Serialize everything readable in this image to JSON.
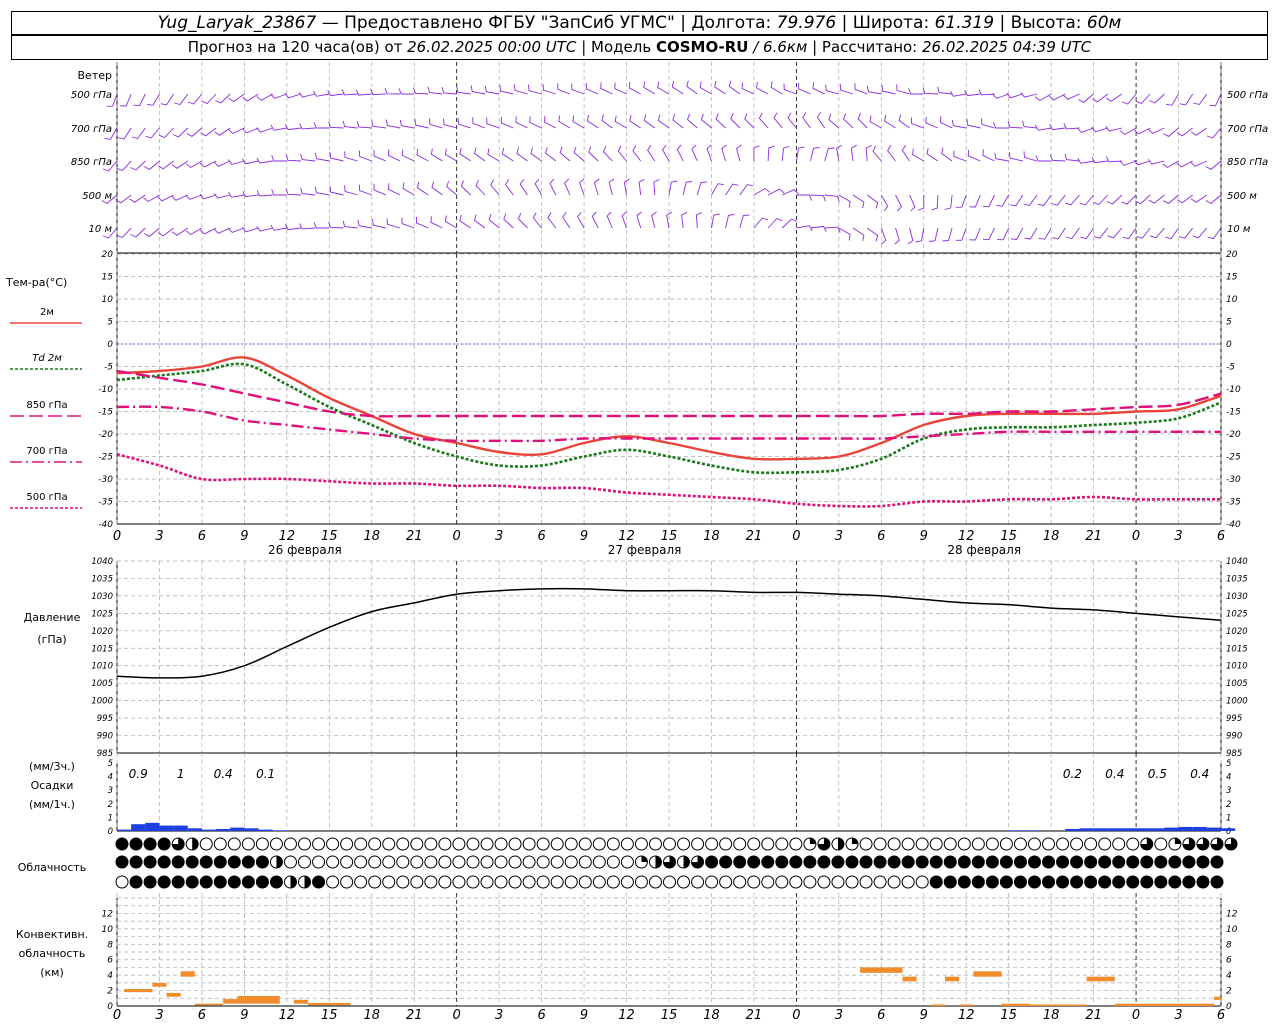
{
  "header": {
    "station": "Yug_Laryak_23867",
    "provider": "— Предоставлено ФГБУ \"ЗапСиб УГМС\"",
    "sep": "|",
    "lon_label": "Долгота:",
    "lon": "79.976",
    "lat_label": "Широта:",
    "lat": "61.319",
    "alt_label": "Высота:",
    "alt": "60м",
    "forecast_label": "Прогноз на 120 часа(ов) от",
    "forecast_start": "26.02.2025 00:00 UTC",
    "model_label": "Модель",
    "model": "COSMO-RU",
    "model_res": "/ 6.6км",
    "computed_label": "Рассчитано:",
    "computed": "26.02.2025 04:39 UTC"
  },
  "wind_panel": {
    "title": "Ветер",
    "levels": [
      "500 гПа",
      "700 гПа",
      "850 гПа",
      "500 м",
      "10 м"
    ],
    "barb_color": "#8a2be2"
  },
  "time_axis": {
    "hour_labels": [
      "0",
      "3",
      "6",
      "9",
      "12",
      "15",
      "18",
      "21",
      "0",
      "3",
      "6",
      "9",
      "12",
      "15",
      "18",
      "21",
      "0",
      "3",
      "6",
      "9",
      "12",
      "15",
      "18",
      "21",
      "0",
      "3",
      "6"
    ],
    "day_labels": [
      "26 февраля",
      "27 февраля",
      "28 февраля"
    ]
  },
  "chart_data": [
    {
      "type": "line",
      "panel": "temperature",
      "ylabel": "Тем-ра(°C)",
      "ylim": [
        -40,
        20
      ],
      "yticks": [
        "20",
        "15",
        "10",
        "5",
        "0",
        "-5",
        "-10",
        "-15",
        "-20",
        "-25",
        "-30",
        "-35",
        "-40"
      ],
      "x_hours": [
        0,
        3,
        6,
        9,
        12,
        15,
        18,
        21,
        24,
        27,
        30,
        33,
        36,
        39,
        42,
        45,
        48,
        51,
        54,
        57,
        60,
        63,
        66,
        69,
        72,
        75,
        78
      ],
      "series": [
        {
          "name": "2м",
          "color": "#e8443a",
          "dash": "solid",
          "values": [
            -6.5,
            -6,
            -5,
            -3,
            -7,
            -12,
            -16,
            -20,
            -22,
            -24,
            -24.5,
            -22,
            -20.5,
            -22,
            -24,
            -25.5,
            -25.5,
            -25,
            -22,
            -18,
            -16,
            -15.5,
            -15.5,
            -15.5,
            -15,
            -14.5,
            -11.5
          ]
        },
        {
          "name": "Td 2м",
          "color": "#1a7a1a",
          "dash": "dot",
          "values": [
            -8,
            -7,
            -6,
            -4.5,
            -9,
            -14,
            -18,
            -22,
            -25,
            -27,
            -27,
            -25,
            -23.5,
            -25,
            -27,
            -28.5,
            -28.5,
            -28,
            -25.5,
            -21,
            -19,
            -18.5,
            -18.5,
            -18,
            -17.5,
            -16.5,
            -13
          ]
        },
        {
          "name": "850 гПа",
          "color": "#e0107a",
          "dash": "longdash",
          "values": [
            -6,
            -7.5,
            -9,
            -11,
            -13,
            -15,
            -16,
            -16,
            -16,
            -16,
            -16,
            -16,
            -16,
            -16,
            -16,
            -16,
            -16,
            -16,
            -16,
            -15.5,
            -15.5,
            -15,
            -15,
            -14.5,
            -14,
            -13.5,
            -11
          ]
        },
        {
          "name": "700 гПа",
          "color": "#e0107a",
          "dash": "dashdot",
          "values": [
            -14,
            -14,
            -15,
            -17,
            -18,
            -19,
            -20,
            -21,
            -21.5,
            -21.5,
            -21.5,
            -21,
            -21,
            -21,
            -21,
            -21,
            -21,
            -21,
            -21,
            -20.5,
            -20,
            -19.5,
            -19.5,
            -19.5,
            -19.5,
            -19.5,
            -19.5
          ]
        },
        {
          "name": "500 гПа",
          "color": "#e0107a",
          "dash": "dot",
          "values": [
            -24.5,
            -27,
            -30,
            -30,
            -30,
            -30.5,
            -31,
            -31,
            -31.5,
            -31.5,
            -32,
            -32,
            -33,
            -33.5,
            -34,
            -34.5,
            -35.5,
            -36,
            -36,
            -35,
            -35,
            -34.5,
            -34.5,
            -34,
            -34.5,
            -34.5,
            -34.5
          ]
        }
      ]
    },
    {
      "type": "line",
      "panel": "pressure",
      "ylabel": "Давление",
      "unit": "(гПа)",
      "ylim": [
        985,
        1040
      ],
      "yticks": [
        "1040",
        "1035",
        "1030",
        "1025",
        "1020",
        "1015",
        "1010",
        "1005",
        "1000",
        "995",
        "990",
        "985"
      ],
      "x_hours": [
        0,
        3,
        6,
        9,
        12,
        15,
        18,
        21,
        24,
        27,
        30,
        33,
        36,
        39,
        42,
        45,
        48,
        51,
        54,
        57,
        60,
        63,
        66,
        69,
        72,
        75,
        78
      ],
      "series": [
        {
          "name": "",
          "color": "#000000",
          "values": [
            1007,
            1006.5,
            1007,
            1010,
            1015.5,
            1021,
            1025.5,
            1028,
            1030.5,
            1031.5,
            1032,
            1032,
            1031.5,
            1031.5,
            1031.5,
            1031,
            1031,
            1030.5,
            1030,
            1029,
            1028,
            1027.5,
            1026.5,
            1026,
            1025,
            1024,
            1023
          ]
        }
      ]
    },
    {
      "type": "bar",
      "panel": "precipitation",
      "ylabel": "Осадки",
      "unit_top": "(мм/3ч.)",
      "unit_bottom": "(мм/1ч.)",
      "ylim": [
        0,
        5
      ],
      "yticks": [
        "5",
        "4",
        "3",
        "2",
        "1",
        "0"
      ],
      "sum_labels": [
        {
          "hour": 1.5,
          "text": "0.9"
        },
        {
          "hour": 4.5,
          "text": "1"
        },
        {
          "hour": 7.5,
          "text": "0.4"
        },
        {
          "hour": 10.5,
          "text": "0.1"
        },
        {
          "hour": 67.5,
          "text": "0.2"
        },
        {
          "hour": 70.5,
          "text": "0.4"
        },
        {
          "hour": 73.5,
          "text": "0.5"
        },
        {
          "hour": 76.5,
          "text": "0.4"
        }
      ],
      "color": "#1f3fe0",
      "hourly": [
        0.1,
        0.5,
        0.6,
        0.4,
        0.4,
        0.2,
        0.1,
        0.15,
        0.25,
        0.2,
        0.1,
        0.05,
        0,
        0,
        0,
        0,
        0,
        0,
        0,
        0,
        0,
        0,
        0,
        0,
        0,
        0,
        0,
        0,
        0,
        0,
        0,
        0,
        0,
        0,
        0,
        0,
        0,
        0,
        0,
        0,
        0,
        0,
        0,
        0,
        0,
        0,
        0,
        0,
        0,
        0,
        0,
        0,
        0,
        0,
        0,
        0,
        0,
        0,
        0,
        0,
        0,
        0,
        0,
        0.05,
        0.05,
        0,
        0,
        0.15,
        0.2,
        0.2,
        0.2,
        0.2,
        0.2,
        0.2,
        0.25,
        0.3,
        0.3,
        0.25,
        0.2
      ]
    },
    {
      "type": "table",
      "panel": "cloudiness",
      "ylabel": "Облачность",
      "rows": [
        {
          "name": "upper",
          "values": [
            1,
            1,
            1,
            1,
            0.75,
            0.5,
            0,
            0,
            0,
            0,
            0,
            0,
            0,
            0,
            0,
            0,
            0,
            0,
            0,
            0,
            0,
            0,
            0,
            0,
            0,
            0,
            0,
            0,
            0,
            0,
            0,
            0,
            0,
            0,
            0,
            0,
            0,
            0,
            0,
            0,
            0,
            0,
            0,
            0,
            0,
            0,
            0,
            0,
            0,
            0.25,
            0.75,
            0.5,
            0.25,
            0,
            0,
            0,
            0,
            0,
            0,
            0,
            0,
            0,
            0,
            0,
            0,
            0,
            0,
            0,
            0,
            0,
            0,
            0,
            0,
            0.75,
            0,
            0.25,
            0.75,
            0.75,
            0.75,
            0.75
          ]
        },
        {
          "name": "middle",
          "values": [
            1,
            1,
            1,
            1,
            1,
            1,
            1,
            1,
            1,
            1,
            1,
            0.5,
            0,
            0,
            0,
            0,
            0,
            0,
            0,
            0,
            0,
            0,
            0,
            0,
            0,
            0,
            0,
            0,
            0,
            0,
            0,
            0,
            0,
            0,
            0,
            0,
            0,
            0.25,
            0.5,
            0.75,
            0.5,
            0.75,
            1,
            1,
            1,
            1,
            1,
            1,
            1,
            1,
            1,
            1,
            1,
            1,
            1,
            1,
            1,
            1,
            1,
            1,
            1,
            1,
            1,
            1,
            1,
            1,
            1,
            1,
            1,
            1,
            1,
            1,
            1,
            1,
            1,
            1,
            1,
            1,
            1
          ]
        },
        {
          "name": "lower",
          "values": [
            0,
            1,
            1,
            1,
            1,
            1,
            1,
            1,
            1,
            1,
            1,
            1,
            0.5,
            0.5,
            1,
            0,
            0,
            0,
            0,
            0,
            0,
            0,
            0,
            0,
            0,
            0,
            0,
            0,
            0,
            0,
            0,
            0,
            0,
            0,
            0,
            0,
            0,
            0,
            0,
            0,
            0,
            0,
            0,
            0,
            0,
            0,
            0,
            0,
            0,
            0,
            0,
            0,
            0,
            0,
            0,
            0,
            0,
            0,
            1,
            1,
            1,
            1,
            1,
            1,
            1,
            1,
            1,
            1,
            1,
            1,
            1,
            1,
            1,
            1,
            1,
            1,
            1,
            1,
            1
          ]
        }
      ]
    },
    {
      "type": "bar",
      "panel": "convective_clouds",
      "ylabel": [
        "Конвективн.",
        "облачность",
        "(км)"
      ],
      "ylim": [
        0,
        14
      ],
      "yticks": [
        "12",
        "10",
        "8",
        "6",
        "4",
        "2",
        "0"
      ],
      "color": "#f08c2c",
      "segments": [
        {
          "from": 0.5,
          "to": 2.5,
          "base": 1.8,
          "top": 2.2
        },
        {
          "from": 2.5,
          "to": 3.5,
          "base": 2.5,
          "top": 3
        },
        {
          "from": 3.5,
          "to": 4.5,
          "base": 1.2,
          "top": 1.7
        },
        {
          "from": 4.5,
          "to": 5.5,
          "base": 3.8,
          "top": 4.5
        },
        {
          "from": 5.5,
          "to": 7.5,
          "base": 0.1,
          "top": 0.3
        },
        {
          "from": 7.5,
          "to": 8.5,
          "base": 0.3,
          "top": 0.9
        },
        {
          "from": 8.5,
          "to": 11.5,
          "base": 0.3,
          "top": 1.3
        },
        {
          "from": 12.5,
          "to": 13.5,
          "base": 0.3,
          "top": 0.8
        },
        {
          "from": 13.5,
          "to": 16.5,
          "base": 0.1,
          "top": 0.4
        },
        {
          "from": 52.5,
          "to": 55.5,
          "base": 4.3,
          "top": 5
        },
        {
          "from": 55.5,
          "to": 56.5,
          "base": 3.2,
          "top": 3.8
        },
        {
          "from": 57.5,
          "to": 58.5,
          "base": 0,
          "top": 0.2
        },
        {
          "from": 58.5,
          "to": 59.5,
          "base": 3.2,
          "top": 3.8
        },
        {
          "from": 59.5,
          "to": 60.5,
          "base": 0,
          "top": 0.2
        },
        {
          "from": 60.5,
          "to": 62.5,
          "base": 3.8,
          "top": 4.5
        },
        {
          "from": 62.5,
          "to": 64.5,
          "base": 0,
          "top": 0.3
        },
        {
          "from": 64.5,
          "to": 68.5,
          "base": 0,
          "top": 0.2
        },
        {
          "from": 68.5,
          "to": 70.5,
          "base": 3.2,
          "top": 3.8
        },
        {
          "from": 70.5,
          "to": 77.5,
          "base": 0,
          "top": 0.3
        },
        {
          "from": 77.5,
          "to": 78,
          "base": 0.8,
          "top": 1.2
        }
      ]
    }
  ]
}
